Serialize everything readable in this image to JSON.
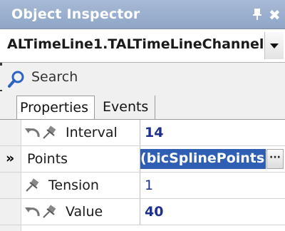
{
  "panel": {
    "title": "Object Inspector",
    "pin_icon": "pin-icon",
    "close_icon": "close-icon",
    "close_glyph": "✖"
  },
  "object_selector": {
    "value": "ALTimeLine1.TALTimeLineChannel",
    "dropdown_icon": "chevron-down-icon"
  },
  "search": {
    "placeholder": "Search",
    "icon": "search-icon"
  },
  "tabs": [
    {
      "label": "Properties",
      "active": true
    },
    {
      "label": "Events",
      "active": false
    }
  ],
  "properties": [
    {
      "name": "Interval",
      "value": "14",
      "bold": true,
      "icons": [
        "undo-icon",
        "pin-icon"
      ]
    },
    {
      "name": "Points",
      "value": "bicSplinePoints)",
      "bold": true,
      "selected": true,
      "marker": "»",
      "editor_button": "···"
    },
    {
      "name": "Tension",
      "value": "1",
      "bold": false,
      "icons": [
        "pin-icon"
      ]
    },
    {
      "name": "Value",
      "value": "40",
      "bold": true,
      "icons": [
        "undo-icon",
        "pin-icon"
      ]
    }
  ],
  "colors": {
    "title_bar": "#a7bad6",
    "selection": "#2f5fb3",
    "value_text": "#1e2f8f"
  }
}
